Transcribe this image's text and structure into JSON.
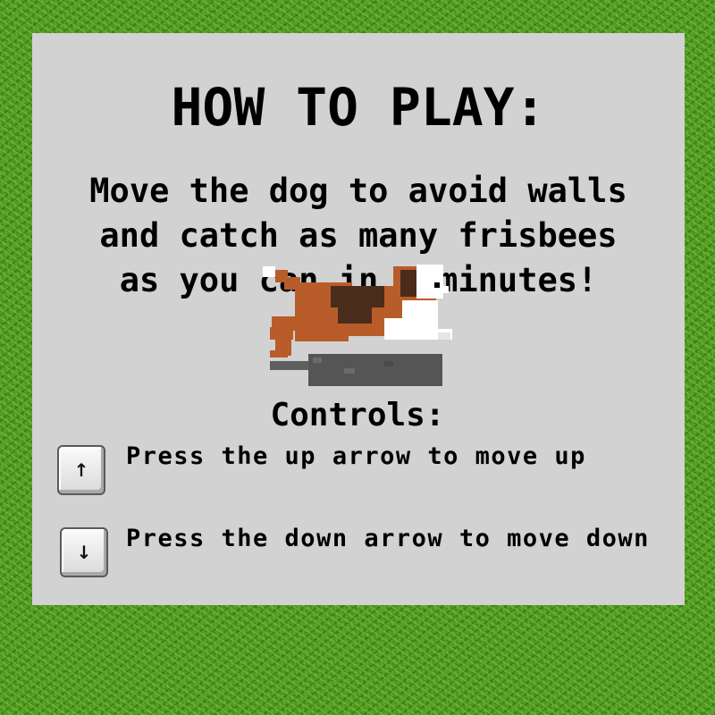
{
  "title": "HOW TO PLAY:",
  "intro": {
    "line1": "Move the dog to avoid walls",
    "line2": "and catch as many frisbees",
    "line3": "as you can in 4 minutes!"
  },
  "controls": {
    "heading": "Controls:",
    "up": {
      "key_icon": "arrow-up-icon",
      "key_glyph": "↑",
      "text": "Press the up arrow to move up"
    },
    "down": {
      "key_icon": "arrow-down-icon",
      "key_glyph": "↓",
      "text": "Press the down arrow to move down"
    }
  },
  "colors": {
    "background_grass": "#4f9a22",
    "panel": "#d2d2d2",
    "text": "#000000",
    "dog_brown": "#b85c2a",
    "dog_dark_patch": "#4a2c1a",
    "dog_white": "#ffffff",
    "shadow": "#555555"
  }
}
